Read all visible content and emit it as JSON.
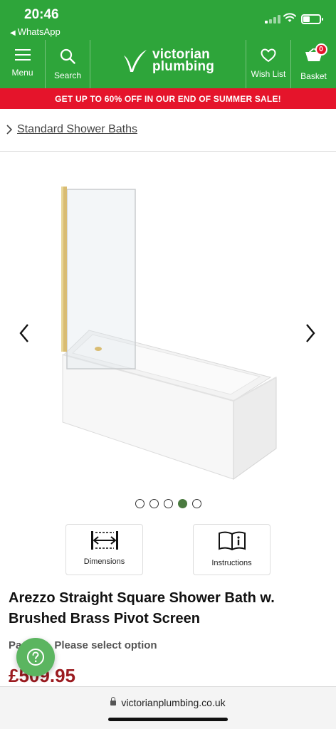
{
  "status_bar": {
    "time": "20:46",
    "back_app": "WhatsApp",
    "signal_bars": 4,
    "signal_bars_active": 1,
    "battery_level": 0.3
  },
  "header": {
    "menu_label": "Menu",
    "search_label": "Search",
    "logo_line1": "victorian",
    "logo_line2": "plumbing",
    "wishlist_label": "Wish List",
    "basket_label": "Basket",
    "basket_count": "0",
    "brand_color": "#2ea53a"
  },
  "promo": {
    "text": "GET UP TO 60% OFF IN OUR END OF SUMMER SALE!",
    "color": "#e5142b"
  },
  "breadcrumb": {
    "label": "Standard Shower Baths"
  },
  "gallery": {
    "total_images": 5,
    "active_index": 3,
    "prev_icon": "chevron-left-icon",
    "next_icon": "chevron-right-icon"
  },
  "doc_buttons": {
    "dimensions_label": "Dimensions",
    "instructions_label": "Instructions"
  },
  "product": {
    "title": "Arezzo Straight Square Shower Bath w. Brushed Brass Pivot Screen",
    "option_prefix": "Pa",
    "option_text": "Please select option",
    "price": "£509.95",
    "price_color": "#9b1b20"
  },
  "browser": {
    "url": "victorianplumbing.co.uk"
  }
}
